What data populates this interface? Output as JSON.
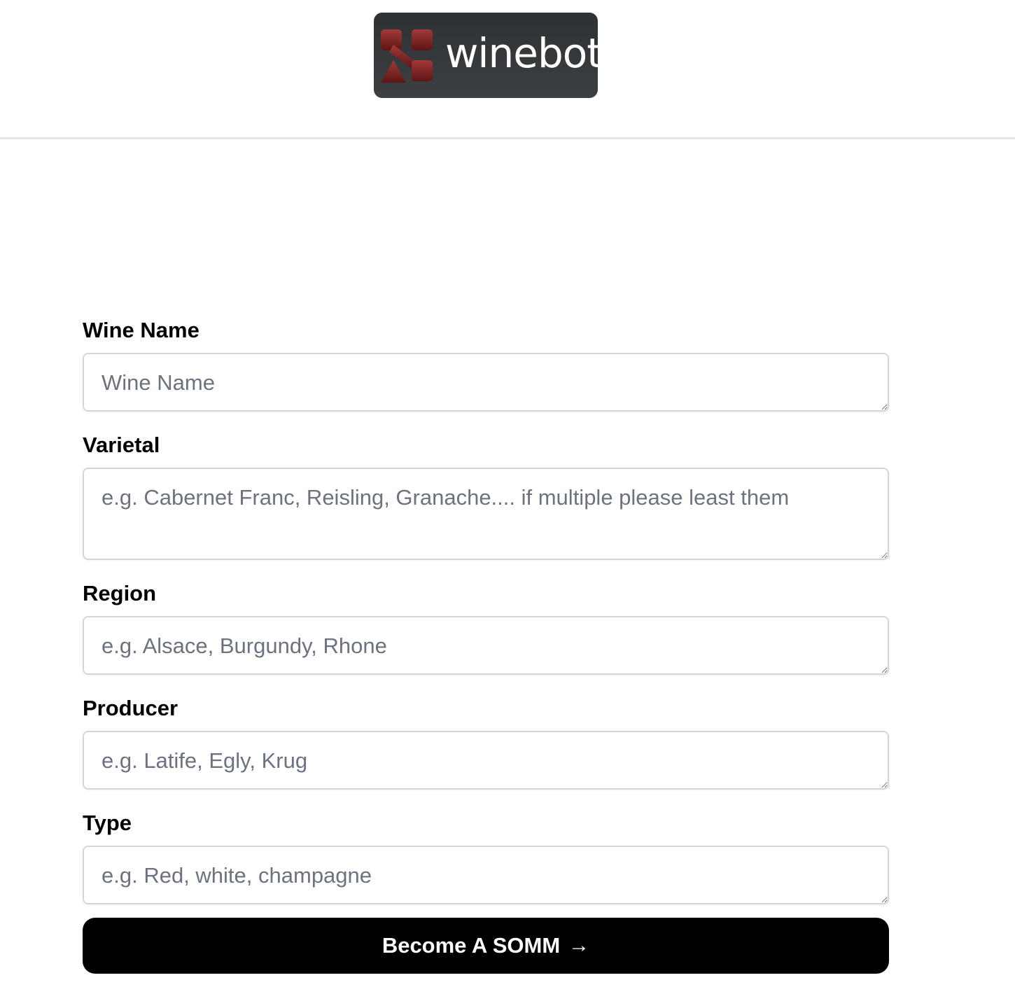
{
  "header": {
    "logo_text": "winebot"
  },
  "form": {
    "fields": [
      {
        "label": "Wine Name",
        "placeholder": "Wine Name",
        "value": ""
      },
      {
        "label": "Varietal",
        "placeholder": "e.g. Cabernet Franc, Reisling, Granache.... if multiple please least them",
        "value": ""
      },
      {
        "label": "Region",
        "placeholder": "e.g. Alsace, Burgundy, Rhone",
        "value": ""
      },
      {
        "label": "Producer",
        "placeholder": "e.g. Latife, Egly, Krug",
        "value": ""
      },
      {
        "label": "Type",
        "placeholder": "e.g. Red, white, champagne",
        "value": ""
      }
    ],
    "submit_label": "Become A SOMM",
    "submit_icon": "→"
  },
  "colors": {
    "logo_background": "#33373a",
    "logo_mark": "#8b2222",
    "button_background": "#000000",
    "placeholder_text": "#6b7280"
  }
}
